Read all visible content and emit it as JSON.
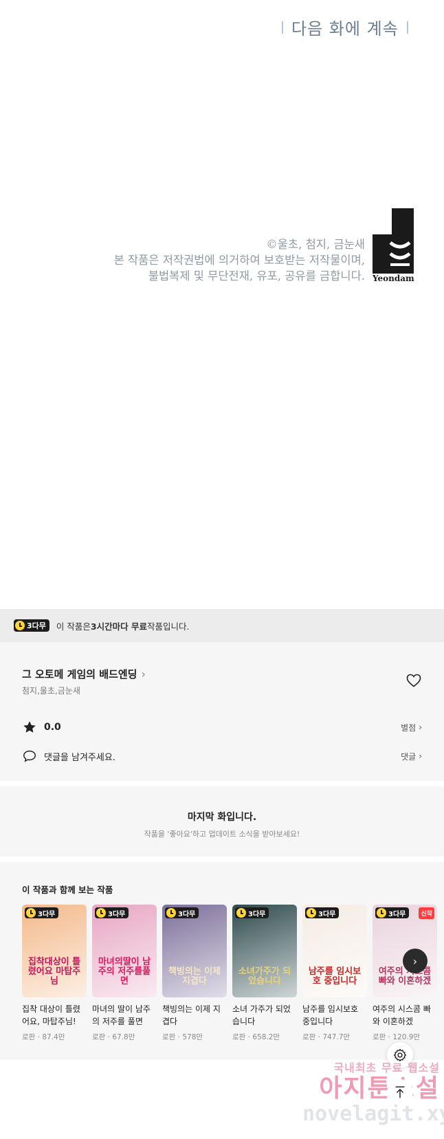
{
  "comic": {
    "next_episode": "다음 화에 계속",
    "copyright_lines": [
      "©울초, 첨지, 금눈새",
      "본 작품은 저작권법에 의거하여 보호받는 저작물이며,",
      "불법복제 및 무단전재, 유포, 공유를 금합니다."
    ],
    "logo_text": "Yeondam"
  },
  "free_banner": {
    "badge": "3다무",
    "text_before": "이 작품은 ",
    "text_bold": "3시간마다 무료",
    "text_after": " 작품입니다."
  },
  "work": {
    "title": "그 오토메 게임의 배드엔딩",
    "authors": "첨지,울초,금눈새",
    "rating": "0.0",
    "rating_link": "별점",
    "comment_prompt": "댓글을 남겨주세요.",
    "comment_link": "댓글"
  },
  "last_episode": {
    "title": "마지막 화입니다.",
    "subtitle": "작품을 '좋아요'하고 업데이트 소식을 받아보세요!"
  },
  "recommendations": {
    "heading": "이 작품과 함께 보는 작품",
    "items": [
      {
        "badge": "3다무",
        "name": "집착 대상이 틀렸어요, 마탑주님!",
        "meta": "로판 · 87.4만",
        "cover_text": "집착대상이 틀렸어요 마탑주님",
        "bg": "#f3b98a",
        "fg": "#c2185b"
      },
      {
        "badge": "3다무",
        "name": "마녀의 딸이 남주의 저주를 풀면",
        "meta": "로판 · 67.8만",
        "cover_text": "마녀의딸이 남주의 저주를풀면",
        "bg": "#e7a6c2",
        "fg": "#d81b60"
      },
      {
        "badge": "3다무",
        "name": "책빙의는 이제 지겹다",
        "meta": "로판 · 578만",
        "cover_text": "책빙의는 이제 지겹다",
        "bg": "#7c6f9a",
        "fg": "#f5e6c8"
      },
      {
        "badge": "3다무",
        "name": "소녀 가주가 되었습니다",
        "meta": "로판 · 658.2만",
        "cover_text": "소녀가주가 되었습니다",
        "bg": "#2e4a4c",
        "fg": "#e9d27a"
      },
      {
        "badge": "3다무",
        "name": "남주를 임시보호 중입니다",
        "meta": "로판 · 747.7만",
        "cover_text": "남주를 임시보호 중입니다",
        "bg": "#f4ece4",
        "fg": "#c62828"
      },
      {
        "badge": "3다무",
        "new": "신작",
        "name": "여주의 시스콤 빠와 이혼하겠",
        "meta": "로판 · 120.9만",
        "cover_text": "여주의 시스콤 빠와 이혼하겠",
        "bg": "#e9d3dc",
        "fg": "#b2355e"
      }
    ]
  },
  "watermark": {
    "line1": "국내최초 무료 웹소설",
    "line2": "아지툰소설",
    "line3": "novelagit.xyz"
  }
}
